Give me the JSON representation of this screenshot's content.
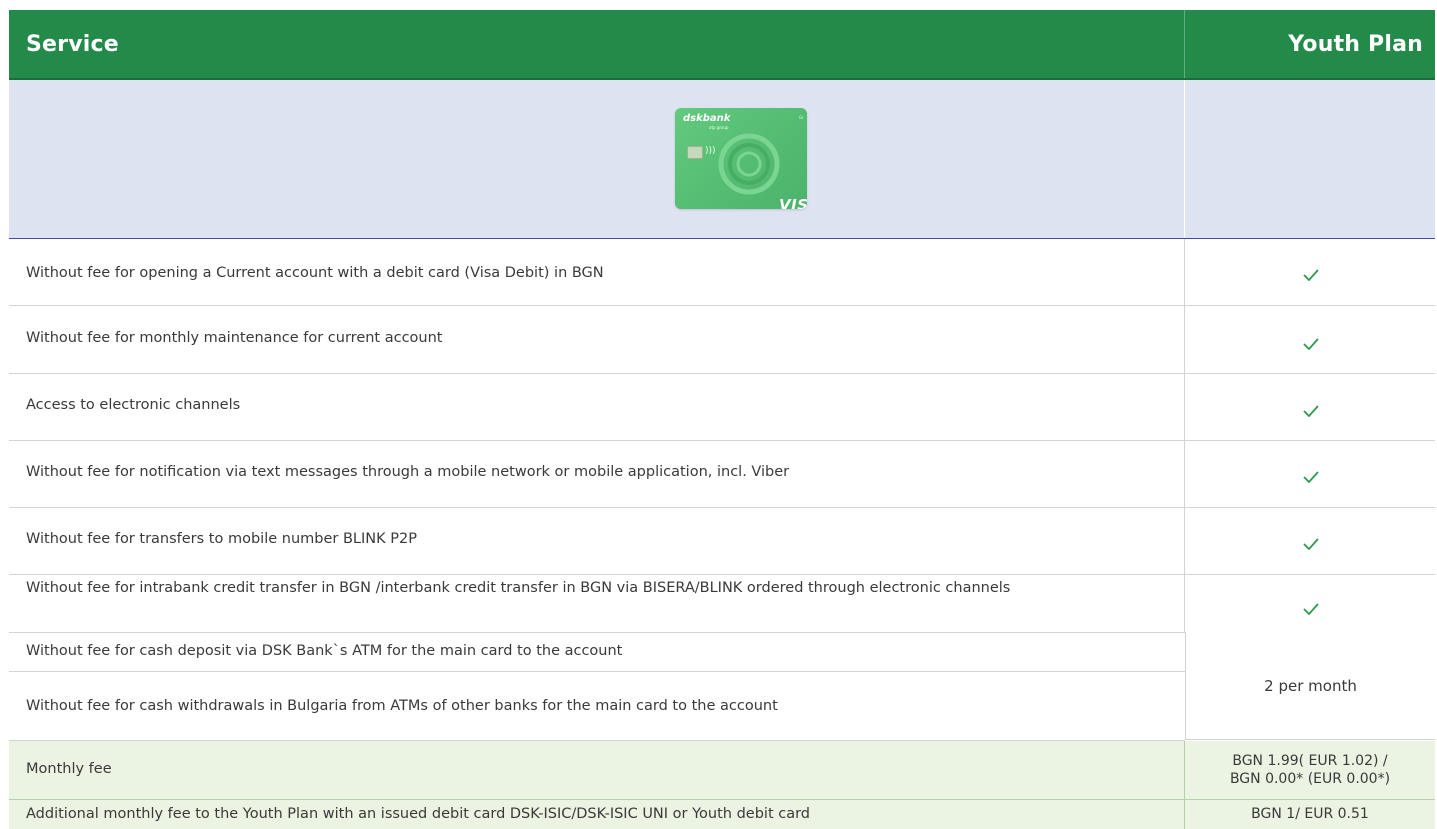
{
  "header": {
    "service_label": "Service",
    "plan_label": "Youth Plan"
  },
  "card": {
    "brand": "dskbank",
    "brand_sub": "otp group",
    "network": "VISA",
    "image_name": "green-visa-debit-card"
  },
  "rows": [
    {
      "label": "Without fee for opening a Current account with a debit card (Visa Debit) in BGN",
      "value_icon": "checkmark-icon"
    },
    {
      "label": "Without fee for monthly maintenance for current account",
      "value_icon": "checkmark-icon"
    },
    {
      "label": "Access to electronic channels",
      "value_icon": "checkmark-icon"
    },
    {
      "label": "Without fee for notification via text messages through a mobile network or mobile application, incl. Viber",
      "value_icon": "checkmark-icon"
    },
    {
      "label": "Without fee for transfers to mobile number BLINK P2P",
      "value_icon": "checkmark-icon"
    },
    {
      "label": "Without fee for intrabank credit transfer in BGN /interbank credit transfer in BGN via BISERA/BLINK ordered through electronic channels",
      "value_icon": "checkmark-icon"
    },
    {
      "label": "Without fee for cash deposit via DSK Bank`s ATM  for the main card to the account"
    },
    {
      "label": "Without  fee for cash withdrawals in Bulgaria from ATMs of other banks for the main card to the account"
    }
  ],
  "merged_value": "2 per month",
  "fees": [
    {
      "label": "Monthly fee",
      "value_line1": "BGN 1.99( EUR 1.02) /",
      "value_line2": "BGN 0.00* (EUR 0.00*)"
    },
    {
      "label": "Additional monthly fee to the Youth Plan with an issued debit card  DSK-ISIC/DSK-ISIC UNI or Youth debit card",
      "value_line1": "BGN 1/ EUR 0.51"
    }
  ],
  "colors": {
    "header_green": "#238a4a",
    "card_row_bg": "#dde3f1",
    "check_green": "#2e9a4e",
    "fee_row_bg": "#ebf3e2"
  }
}
